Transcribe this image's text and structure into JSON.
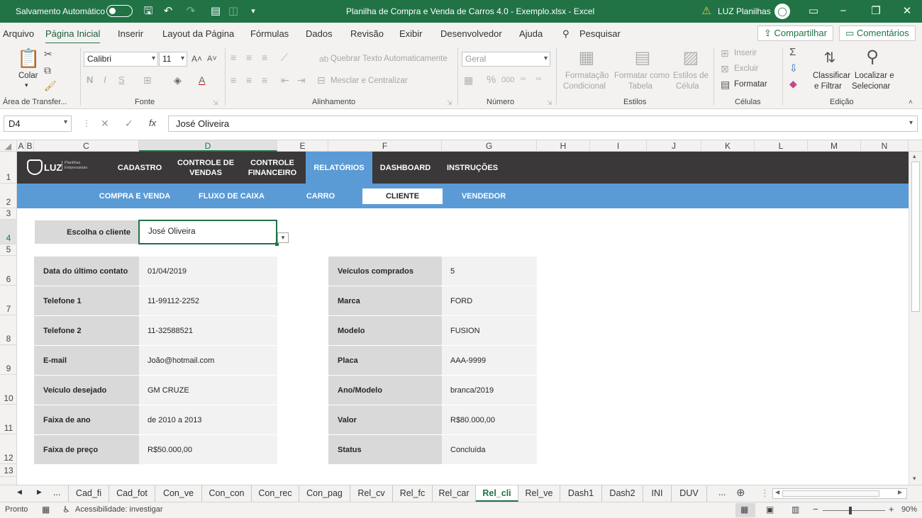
{
  "titlebar": {
    "autosave_label": "Salvamento Automático",
    "file_title": "Planilha de Compra e Venda de Carros 4.0 - Exemplo.xlsx  -  Excel",
    "user_name": "LUZ Planilhas",
    "accent": "#217346"
  },
  "menu": {
    "items": [
      "Arquivo",
      "Página Inicial",
      "Inserir",
      "Layout da Página",
      "Fórmulas",
      "Dados",
      "Revisão",
      "Exibir",
      "Desenvolvedor",
      "Ajuda"
    ],
    "active": "Página Inicial",
    "search": "Pesquisar",
    "share": "Compartilhar",
    "comments": "Comentários"
  },
  "ribbon": {
    "paste_label": "Colar",
    "font_name": "Calibri",
    "font_size": "11",
    "wrap_text": "Quebrar Texto Automaticamente",
    "merge_center": "Mesclar e Centralizar",
    "number_format": "Geral",
    "cond_format_1": "Formatação",
    "cond_format_2": "Condicional",
    "format_table_1": "Formatar como",
    "format_table_2": "Tabela",
    "cell_styles_1": "Estilos de",
    "cell_styles_2": "Célula",
    "insert": "Inserir",
    "delete": "Excluir",
    "format": "Formatar",
    "sort_1": "Classificar",
    "sort_2": "e Filtrar",
    "find_1": "Localizar e",
    "find_2": "Selecionar",
    "groups": {
      "clipboard": "Área de Transfer...",
      "font": "Fonte",
      "alignment": "Alinhamento",
      "number": "Número",
      "styles": "Estilos",
      "cells": "Células",
      "editing": "Edição"
    }
  },
  "formula_bar": {
    "name_box": "D4",
    "content": "José Oliveira"
  },
  "columns": [
    "A",
    "B",
    "C",
    "D",
    "E",
    "F",
    "G",
    "H",
    "I",
    "J",
    "K",
    "L",
    "M",
    "N"
  ],
  "rows": [
    "1",
    "2",
    "3",
    "4",
    "5",
    "6",
    "7",
    "8",
    "9",
    "10",
    "11",
    "12",
    "13"
  ],
  "sheet": {
    "logo": "LUZ",
    "logo_sub": "Planilhas Empresariais",
    "nav_main": [
      {
        "label": "CADASTRO"
      },
      {
        "label": "CONTROLE DE VENDAS"
      },
      {
        "label": "CONTROLE FINANCEIRO"
      },
      {
        "label": "RELATÓRIOS"
      },
      {
        "label": "DASHBOARD"
      },
      {
        "label": "INSTRUÇÕES"
      }
    ],
    "nav_sub": [
      {
        "label": "COMPRA E VENDA"
      },
      {
        "label": "FLUXO DE CAIXA"
      },
      {
        "label": "CARRO"
      },
      {
        "label": "CLIENTE"
      },
      {
        "label": "VENDEDOR"
      }
    ],
    "choose_label": "Escolha o cliente",
    "choose_value": "José Oliveira",
    "left_table": [
      {
        "label": "Data do último contato",
        "value": "01/04/2019"
      },
      {
        "label": "Telefone 1",
        "value": "11-99112-2252"
      },
      {
        "label": "Telefone 2",
        "value": "11-32588521"
      },
      {
        "label": "E-mail",
        "value": "João@hotmail.com"
      },
      {
        "label": "Veículo desejado",
        "value": "GM CRUZE"
      },
      {
        "label": "Faixa de ano",
        "value": "de 2010 a 2013"
      },
      {
        "label": "Faixa de preço",
        "value": "R$50.000,00"
      }
    ],
    "right_table": [
      {
        "label": "Veículos comprados",
        "value": "5"
      },
      {
        "label": "Marca",
        "value": "FORD"
      },
      {
        "label": "Modelo",
        "value": "FUSION"
      },
      {
        "label": "Placa",
        "value": "AAA-9999"
      },
      {
        "label": "Ano/Modelo",
        "value": "branca/2019"
      },
      {
        "label": "Valor",
        "value": "R$80.000,00"
      },
      {
        "label": "Status",
        "value": "Concluída"
      }
    ],
    "colors": {
      "dark_nav": "#3a3838",
      "blue_nav": "#5b9bd5"
    }
  },
  "tabs": {
    "items": [
      "Cad_fi",
      "Cad_fot",
      "Con_ve",
      "Con_con",
      "Con_rec",
      "Con_pag",
      "Rel_cv",
      "Rel_fc",
      "Rel_car",
      "Rel_cli",
      "Rel_ve",
      "Dash1",
      "Dash2",
      "INI",
      "DUV"
    ],
    "active": "Rel_cli",
    "ellipsis": "..."
  },
  "status": {
    "ready": "Pronto",
    "accessibility": "Acessibilidade: investigar",
    "zoom": "90%"
  }
}
